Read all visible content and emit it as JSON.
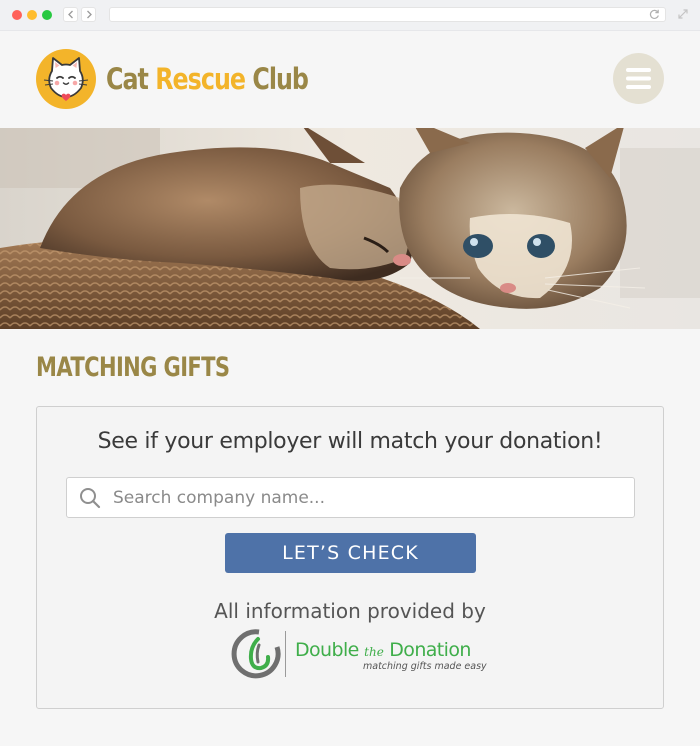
{
  "brand": {
    "name_part1": "Cat ",
    "name_part2": "Rescue ",
    "name_part3": "Club",
    "colors": {
      "olive": "#9a8747",
      "gold": "#f3b42a",
      "button_blue": "#4e72a8",
      "partner_green": "#3fae4a"
    }
  },
  "header": {
    "menu_icon": "hamburger-icon",
    "logo_icon": "cat-face-icon"
  },
  "hero": {
    "image_subject": "two kittens in a woven basket"
  },
  "main": {
    "title": "MATCHING GIFTS",
    "prompt": "See if your employer will match your donation!",
    "search": {
      "placeholder": "Search company name...",
      "value": "",
      "icon": "search-icon"
    },
    "button_label": "LET’S CHECK",
    "provided_by": "All information provided by",
    "partner": {
      "name_1": "Double ",
      "name_2": "the",
      "name_3": " Donation",
      "tagline": "matching gifts made easy"
    }
  }
}
